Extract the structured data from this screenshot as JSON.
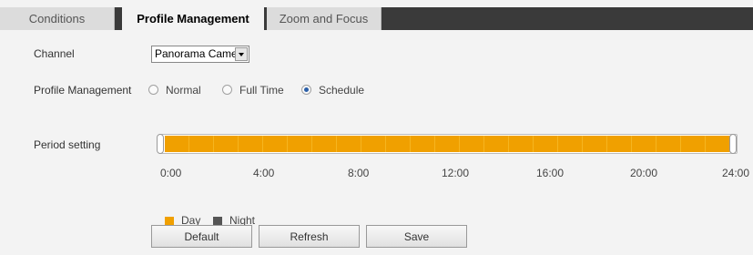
{
  "tabs": [
    {
      "label": "Conditions",
      "active": false
    },
    {
      "label": "Profile Management",
      "active": true
    },
    {
      "label": "Zoom and Focus",
      "active": false
    }
  ],
  "channel": {
    "label": "Channel",
    "value": "Panorama Came"
  },
  "profile_management": {
    "label": "Profile Management",
    "options": [
      {
        "label": "Normal",
        "checked": false
      },
      {
        "label": "Full Time",
        "checked": false
      },
      {
        "label": "Schedule",
        "checked": true
      }
    ]
  },
  "period_setting": {
    "label": "Period setting",
    "day_range_hours": [
      0,
      24
    ],
    "ticks": [
      "0:00",
      "4:00",
      "8:00",
      "12:00",
      "16:00",
      "20:00",
      "24:00"
    ],
    "legend": [
      {
        "label": "Day",
        "color": "#f0a000"
      },
      {
        "label": "Night",
        "color": "#555555"
      }
    ]
  },
  "buttons": {
    "default": "Default",
    "refresh": "Refresh",
    "save": "Save"
  }
}
